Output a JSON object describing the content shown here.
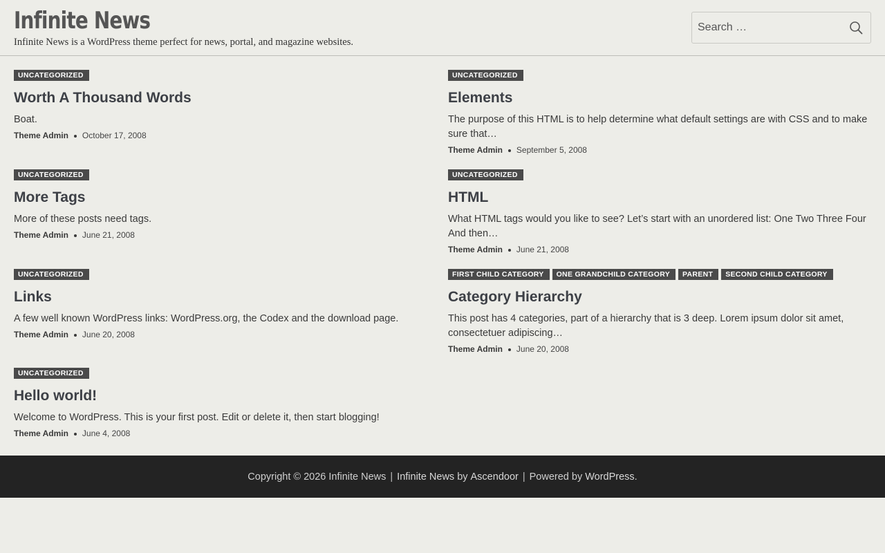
{
  "header": {
    "site_title": "Infinite News",
    "tagline": "Infinite News is a WordPress theme perfect for news, portal, and magazine websites.",
    "search_placeholder": "Search …"
  },
  "posts": [
    {
      "categories": [
        "UNCATEGORIZED"
      ],
      "title": "Worth A Thousand Words",
      "excerpt": "Boat.",
      "author": "Theme Admin",
      "date": "October 17, 2008"
    },
    {
      "categories": [
        "UNCATEGORIZED"
      ],
      "title": "Elements",
      "excerpt": "The purpose of this HTML is to help determine what default settings are with CSS and to make sure that…",
      "author": "Theme Admin",
      "date": "September 5, 2008"
    },
    {
      "categories": [
        "UNCATEGORIZED"
      ],
      "title": "More Tags",
      "excerpt": "More of these posts need tags.",
      "author": "Theme Admin",
      "date": "June 21, 2008"
    },
    {
      "categories": [
        "UNCATEGORIZED"
      ],
      "title": "HTML",
      "excerpt": "What HTML tags would you like to see? Let’s start with an unordered list: One Two Three Four And then…",
      "author": "Theme Admin",
      "date": "June 21, 2008"
    },
    {
      "categories": [
        "UNCATEGORIZED"
      ],
      "title": "Links",
      "excerpt": "A few well known WordPress links: WordPress.org, the Codex and the download page.",
      "author": "Theme Admin",
      "date": "June 20, 2008"
    },
    {
      "categories": [
        "FIRST CHILD CATEGORY",
        "ONE GRANDCHILD CATEGORY",
        "PARENT",
        "SECOND CHILD CATEGORY"
      ],
      "title": "Category Hierarchy",
      "excerpt": "This post has 4 categories, part of a hierarchy that is 3 deep. Lorem ipsum dolor sit amet, consectetuer adipiscing…",
      "author": "Theme Admin",
      "date": "June 20, 2008"
    },
    {
      "categories": [
        "UNCATEGORIZED"
      ],
      "title": "Hello world!",
      "excerpt": "Welcome to WordPress. This is your first post. Edit or delete it, then start blogging!",
      "author": "Theme Admin",
      "date": "June 4, 2008"
    }
  ],
  "footer": {
    "copyright": "Copyright © 2026 Infinite News",
    "theme_name": "Infinite News",
    "by_text": "by",
    "theme_author": "Ascendoor",
    "powered_text": "Powered by",
    "powered_link": "WordPress",
    "period": "."
  },
  "icons": {
    "search": "search-icon",
    "meta_separator": "dot"
  },
  "colors": {
    "background": "#edede8",
    "category_badge": "#4a4a4a",
    "footer_bg": "#232323"
  }
}
